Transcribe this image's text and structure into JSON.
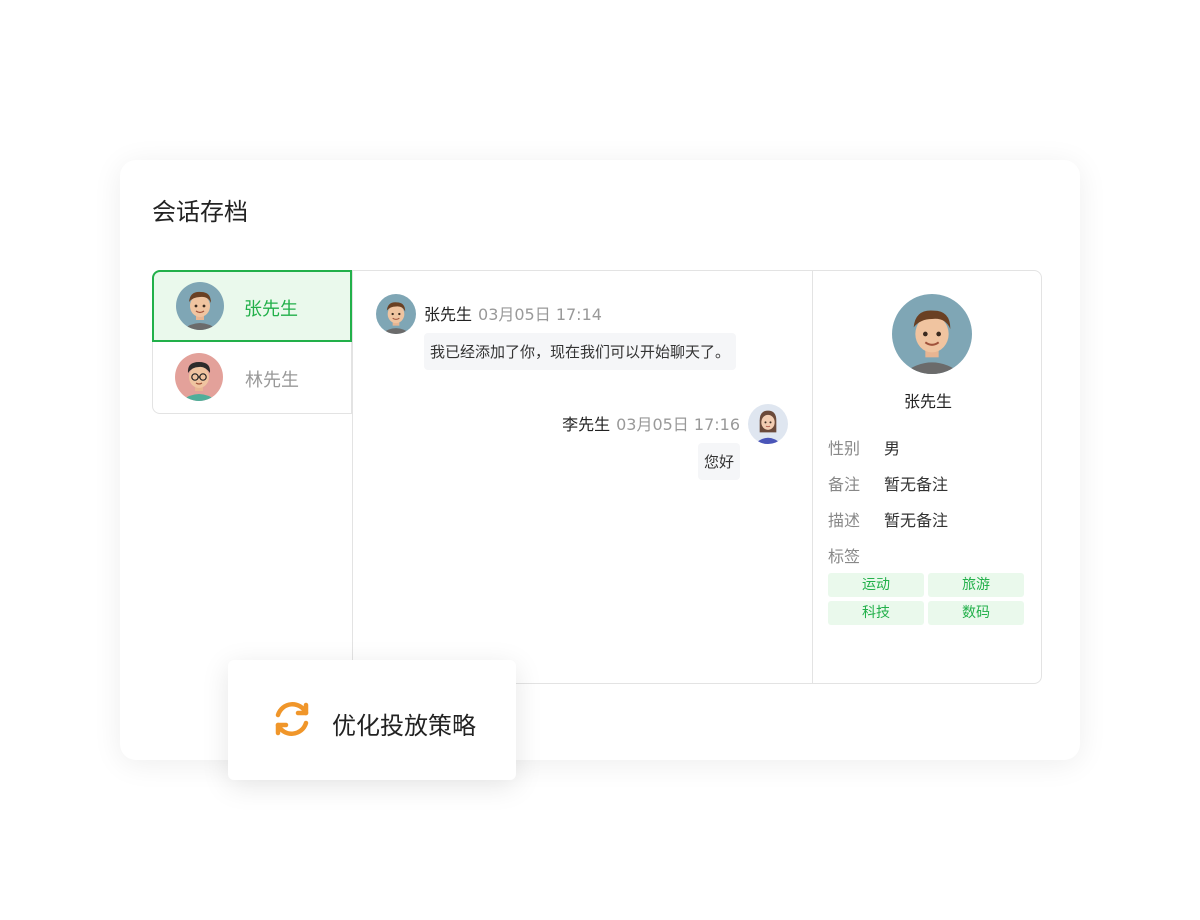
{
  "page_title": "会话存档",
  "contacts": [
    {
      "name": "张先生",
      "active": true,
      "avatar_icon": "boy-avatar-icon"
    },
    {
      "name": "林先生",
      "active": false,
      "avatar_icon": "glasses-boy-avatar-icon"
    }
  ],
  "messages": [
    {
      "sender": "张先生",
      "time": "03月05日 17:14",
      "text": "我已经添加了你，现在我们可以开始聊天了。",
      "side": "left"
    },
    {
      "sender": "李先生",
      "time": "03月05日 17:16",
      "text": "您好",
      "side": "right"
    }
  ],
  "profile": {
    "name": "张先生",
    "fields": [
      {
        "label": "性别",
        "value": "男"
      },
      {
        "label": "备注",
        "value": "暂无备注"
      },
      {
        "label": "描述",
        "value": "暂无备注"
      }
    ],
    "tags_label": "标签",
    "tags": [
      "运动",
      "旅游",
      "科技",
      "数码"
    ]
  },
  "popup": {
    "label": "优化投放策略",
    "icon": "refresh-icon"
  },
  "colors": {
    "accent": "#22b04a",
    "accent_bg": "#eaf9ec",
    "popup_icon": "#f0962a"
  }
}
